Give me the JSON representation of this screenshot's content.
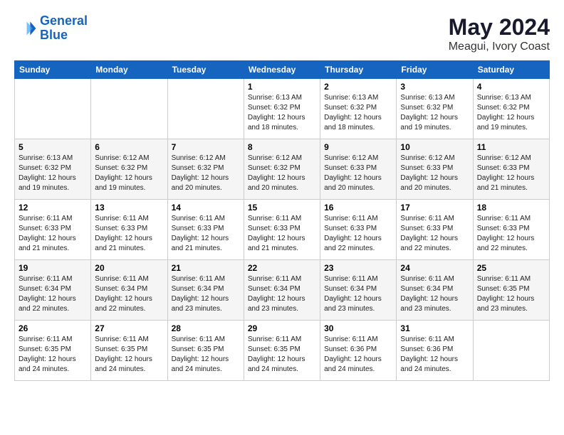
{
  "header": {
    "logo_line1": "General",
    "logo_line2": "Blue",
    "month_year": "May 2024",
    "location": "Meagui, Ivory Coast"
  },
  "weekdays": [
    "Sunday",
    "Monday",
    "Tuesday",
    "Wednesday",
    "Thursday",
    "Friday",
    "Saturday"
  ],
  "weeks": [
    [
      {
        "day": "",
        "info": ""
      },
      {
        "day": "",
        "info": ""
      },
      {
        "day": "",
        "info": ""
      },
      {
        "day": "1",
        "info": "Sunrise: 6:13 AM\nSunset: 6:32 PM\nDaylight: 12 hours\nand 18 minutes."
      },
      {
        "day": "2",
        "info": "Sunrise: 6:13 AM\nSunset: 6:32 PM\nDaylight: 12 hours\nand 18 minutes."
      },
      {
        "day": "3",
        "info": "Sunrise: 6:13 AM\nSunset: 6:32 PM\nDaylight: 12 hours\nand 19 minutes."
      },
      {
        "day": "4",
        "info": "Sunrise: 6:13 AM\nSunset: 6:32 PM\nDaylight: 12 hours\nand 19 minutes."
      }
    ],
    [
      {
        "day": "5",
        "info": "Sunrise: 6:13 AM\nSunset: 6:32 PM\nDaylight: 12 hours\nand 19 minutes."
      },
      {
        "day": "6",
        "info": "Sunrise: 6:12 AM\nSunset: 6:32 PM\nDaylight: 12 hours\nand 19 minutes."
      },
      {
        "day": "7",
        "info": "Sunrise: 6:12 AM\nSunset: 6:32 PM\nDaylight: 12 hours\nand 20 minutes."
      },
      {
        "day": "8",
        "info": "Sunrise: 6:12 AM\nSunset: 6:32 PM\nDaylight: 12 hours\nand 20 minutes."
      },
      {
        "day": "9",
        "info": "Sunrise: 6:12 AM\nSunset: 6:33 PM\nDaylight: 12 hours\nand 20 minutes."
      },
      {
        "day": "10",
        "info": "Sunrise: 6:12 AM\nSunset: 6:33 PM\nDaylight: 12 hours\nand 20 minutes."
      },
      {
        "day": "11",
        "info": "Sunrise: 6:12 AM\nSunset: 6:33 PM\nDaylight: 12 hours\nand 21 minutes."
      }
    ],
    [
      {
        "day": "12",
        "info": "Sunrise: 6:11 AM\nSunset: 6:33 PM\nDaylight: 12 hours\nand 21 minutes."
      },
      {
        "day": "13",
        "info": "Sunrise: 6:11 AM\nSunset: 6:33 PM\nDaylight: 12 hours\nand 21 minutes."
      },
      {
        "day": "14",
        "info": "Sunrise: 6:11 AM\nSunset: 6:33 PM\nDaylight: 12 hours\nand 21 minutes."
      },
      {
        "day": "15",
        "info": "Sunrise: 6:11 AM\nSunset: 6:33 PM\nDaylight: 12 hours\nand 21 minutes."
      },
      {
        "day": "16",
        "info": "Sunrise: 6:11 AM\nSunset: 6:33 PM\nDaylight: 12 hours\nand 22 minutes."
      },
      {
        "day": "17",
        "info": "Sunrise: 6:11 AM\nSunset: 6:33 PM\nDaylight: 12 hours\nand 22 minutes."
      },
      {
        "day": "18",
        "info": "Sunrise: 6:11 AM\nSunset: 6:33 PM\nDaylight: 12 hours\nand 22 minutes."
      }
    ],
    [
      {
        "day": "19",
        "info": "Sunrise: 6:11 AM\nSunset: 6:34 PM\nDaylight: 12 hours\nand 22 minutes."
      },
      {
        "day": "20",
        "info": "Sunrise: 6:11 AM\nSunset: 6:34 PM\nDaylight: 12 hours\nand 22 minutes."
      },
      {
        "day": "21",
        "info": "Sunrise: 6:11 AM\nSunset: 6:34 PM\nDaylight: 12 hours\nand 23 minutes."
      },
      {
        "day": "22",
        "info": "Sunrise: 6:11 AM\nSunset: 6:34 PM\nDaylight: 12 hours\nand 23 minutes."
      },
      {
        "day": "23",
        "info": "Sunrise: 6:11 AM\nSunset: 6:34 PM\nDaylight: 12 hours\nand 23 minutes."
      },
      {
        "day": "24",
        "info": "Sunrise: 6:11 AM\nSunset: 6:34 PM\nDaylight: 12 hours\nand 23 minutes."
      },
      {
        "day": "25",
        "info": "Sunrise: 6:11 AM\nSunset: 6:35 PM\nDaylight: 12 hours\nand 23 minutes."
      }
    ],
    [
      {
        "day": "26",
        "info": "Sunrise: 6:11 AM\nSunset: 6:35 PM\nDaylight: 12 hours\nand 24 minutes."
      },
      {
        "day": "27",
        "info": "Sunrise: 6:11 AM\nSunset: 6:35 PM\nDaylight: 12 hours\nand 24 minutes."
      },
      {
        "day": "28",
        "info": "Sunrise: 6:11 AM\nSunset: 6:35 PM\nDaylight: 12 hours\nand 24 minutes."
      },
      {
        "day": "29",
        "info": "Sunrise: 6:11 AM\nSunset: 6:35 PM\nDaylight: 12 hours\nand 24 minutes."
      },
      {
        "day": "30",
        "info": "Sunrise: 6:11 AM\nSunset: 6:36 PM\nDaylight: 12 hours\nand 24 minutes."
      },
      {
        "day": "31",
        "info": "Sunrise: 6:11 AM\nSunset: 6:36 PM\nDaylight: 12 hours\nand 24 minutes."
      },
      {
        "day": "",
        "info": ""
      }
    ]
  ]
}
